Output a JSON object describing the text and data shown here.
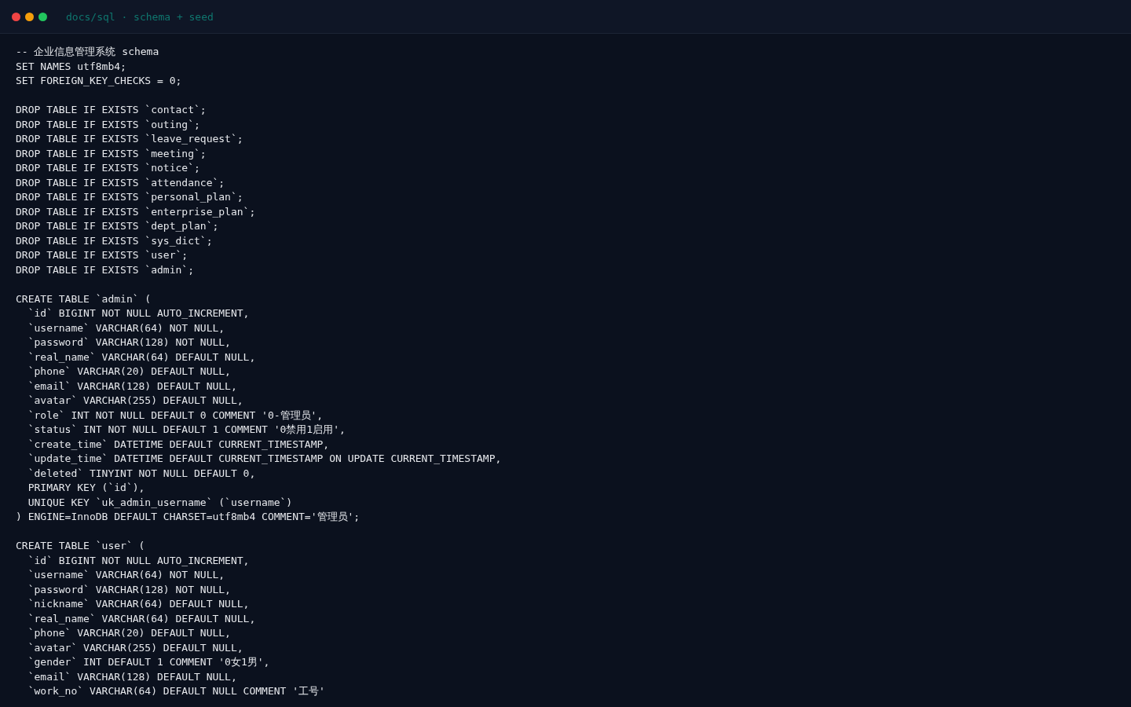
{
  "window": {
    "title": "docs/sql · schema + seed",
    "controls": [
      {
        "color": "#ef4444"
      },
      {
        "color": "#f59e0b"
      },
      {
        "color": "#22c55e"
      }
    ]
  },
  "code": {
    "blocks": [
      {
        "lines": [
          "-- 企业信息管理系统 schema",
          "SET NAMES utf8mb4;",
          "SET FOREIGN_KEY_CHECKS = 0;"
        ]
      },
      {
        "lines": [
          "DROP TABLE IF EXISTS `contact`;",
          "DROP TABLE IF EXISTS `outing`;",
          "DROP TABLE IF EXISTS `leave_request`;",
          "DROP TABLE IF EXISTS `meeting`;",
          "DROP TABLE IF EXISTS `notice`;",
          "DROP TABLE IF EXISTS `attendance`;",
          "DROP TABLE IF EXISTS `personal_plan`;",
          "DROP TABLE IF EXISTS `enterprise_plan`;",
          "DROP TABLE IF EXISTS `dept_plan`;",
          "DROP TABLE IF EXISTS `sys_dict`;",
          "DROP TABLE IF EXISTS `user`;",
          "DROP TABLE IF EXISTS `admin`;"
        ]
      },
      {
        "lines": [
          "CREATE TABLE `admin` (",
          "  `id` BIGINT NOT NULL AUTO_INCREMENT,",
          "  `username` VARCHAR(64) NOT NULL,",
          "  `password` VARCHAR(128) NOT NULL,",
          "  `real_name` VARCHAR(64) DEFAULT NULL,",
          "  `phone` VARCHAR(20) DEFAULT NULL,",
          "  `email` VARCHAR(128) DEFAULT NULL,",
          "  `avatar` VARCHAR(255) DEFAULT NULL,",
          "  `role` INT NOT NULL DEFAULT 0 COMMENT '0-管理员',",
          "  `status` INT NOT NULL DEFAULT 1 COMMENT '0禁用1启用',",
          "  `create_time` DATETIME DEFAULT CURRENT_TIMESTAMP,",
          "  `update_time` DATETIME DEFAULT CURRENT_TIMESTAMP ON UPDATE CURRENT_TIMESTAMP,",
          "  `deleted` TINYINT NOT NULL DEFAULT 0,",
          "  PRIMARY KEY (`id`),",
          "  UNIQUE KEY `uk_admin_username` (`username`)",
          ") ENGINE=InnoDB DEFAULT CHARSET=utf8mb4 COMMENT='管理员';"
        ]
      },
      {
        "lines": [
          "CREATE TABLE `user` (",
          "  `id` BIGINT NOT NULL AUTO_INCREMENT,",
          "  `username` VARCHAR(64) NOT NULL,",
          "  `password` VARCHAR(128) NOT NULL,",
          "  `nickname` VARCHAR(64) DEFAULT NULL,",
          "  `real_name` VARCHAR(64) DEFAULT NULL,",
          "  `phone` VARCHAR(20) DEFAULT NULL,",
          "  `avatar` VARCHAR(255) DEFAULT NULL,",
          "  `gender` INT DEFAULT 1 COMMENT '0女1男',",
          "  `email` VARCHAR(128) DEFAULT NULL,",
          "  `work_no` VARCHAR(64) DEFAULT NULL COMMENT '工号'"
        ]
      }
    ]
  }
}
